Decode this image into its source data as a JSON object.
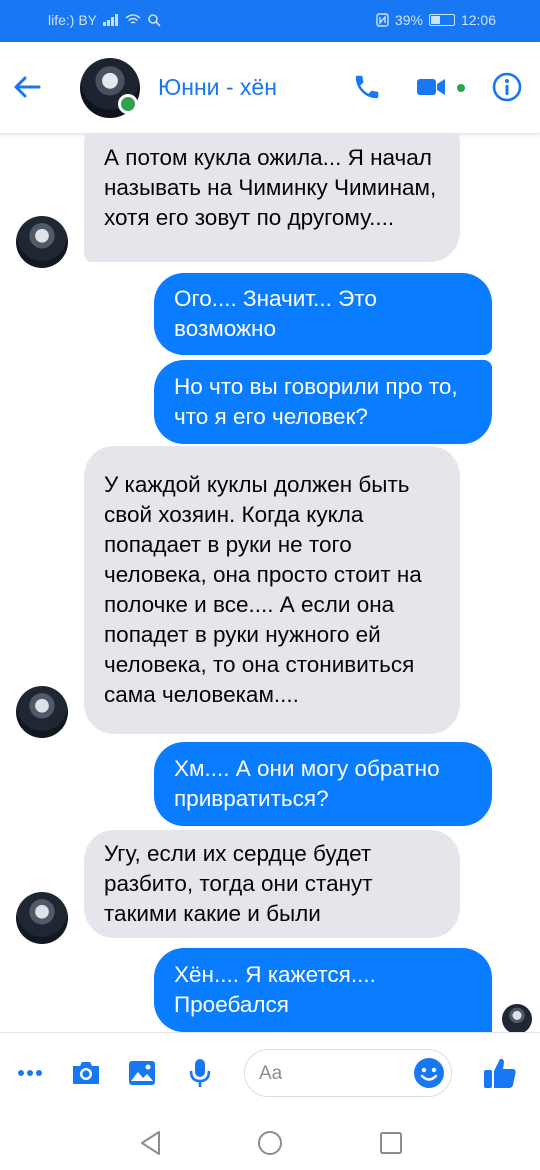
{
  "status_bar": {
    "carrier": "life:) BY",
    "battery": "39%",
    "time": "12:06"
  },
  "header": {
    "contact_name": "Юнни - хён"
  },
  "messages": [
    {
      "from": "contact",
      "text": "А потом кукла ожила... Я начал называть на Чиминку Чиминам, хотя его зовут по другому...."
    },
    {
      "from": "me",
      "text": "Ого.... Значит... Это возможно"
    },
    {
      "from": "me",
      "text": "Но что вы говорили про то, что я его человек?"
    },
    {
      "from": "contact",
      "text": "У каждой куклы должен быть свой хозяин. Когда кукла попадает в руки не того человека, она просто стоит на полочке и все.... А если она попадет в руки нужного ей человека, то она стонивиться сама человекам...."
    },
    {
      "from": "me",
      "text": "Хм.... А они могу обратно привратиться?"
    },
    {
      "from": "contact",
      "text": "Угу, если их сердце будет разбито, тогда они станут такими какие и были"
    },
    {
      "from": "me",
      "text": "Хён.... Я кажется.... Проебался"
    }
  ],
  "composer": {
    "placeholder": "Aa"
  },
  "colors": {
    "brand": "#1877f2",
    "outgoing_bubble": "#0a7cff",
    "incoming_bubble": "#e4e6eb",
    "online": "#31a24c"
  }
}
